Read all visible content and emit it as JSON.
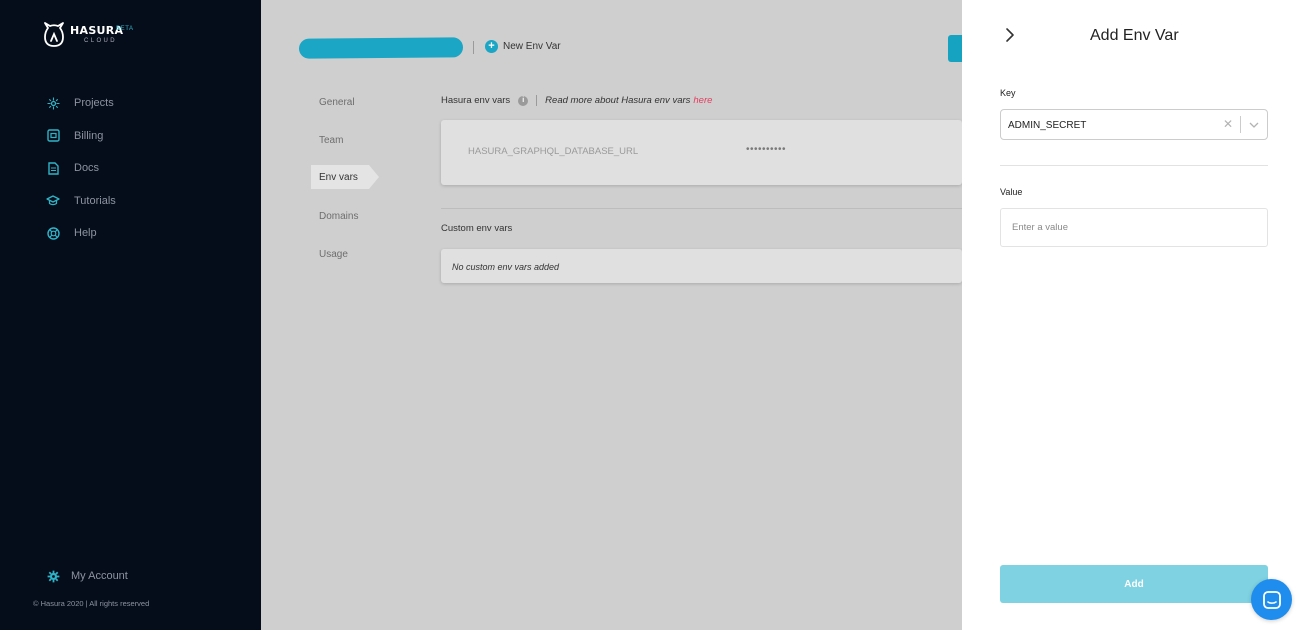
{
  "sidebar": {
    "logo": {
      "word": "HASURA",
      "badge": "BETA",
      "sub": "CLOUD"
    },
    "items": [
      {
        "label": "Projects",
        "icon": "projects-icon"
      },
      {
        "label": "Billing",
        "icon": "billing-icon"
      },
      {
        "label": "Docs",
        "icon": "docs-icon"
      },
      {
        "label": "Tutorials",
        "icon": "graduation-cap-icon"
      },
      {
        "label": "Help",
        "icon": "lifebuoy-icon"
      }
    ],
    "account": {
      "label": "My Account",
      "icon": "gear-icon"
    },
    "copyright": "© Hasura 2020  |  All rights reserved"
  },
  "header": {
    "new_env_label": "New Env Var"
  },
  "subnav": {
    "items": [
      {
        "label": "General",
        "active": false
      },
      {
        "label": "Team",
        "active": false
      },
      {
        "label": "Env vars",
        "active": true
      },
      {
        "label": "Domains",
        "active": false
      },
      {
        "label": "Usage",
        "active": false
      }
    ]
  },
  "env": {
    "title": "Hasura env vars",
    "read_more": "Read more about Hasura env vars",
    "read_more_link": "here",
    "system_var": {
      "key": "HASURA_GRAPHQL_DATABASE_URL",
      "value": "••••••••••"
    },
    "custom_title": "Custom env vars",
    "custom_empty": "No custom env vars added"
  },
  "drawer": {
    "title": "Add Env Var",
    "key_label": "Key",
    "key_value": "ADMIN_SECRET",
    "value_label": "Value",
    "value_placeholder": "Enter a value",
    "add_label": "Add"
  },
  "colors": {
    "sidebar_bg": "#060d1a",
    "accent": "#1aa6c4",
    "link": "#e33e5f",
    "add_button": "#7fd2e1",
    "chat": "#1f8ded"
  }
}
